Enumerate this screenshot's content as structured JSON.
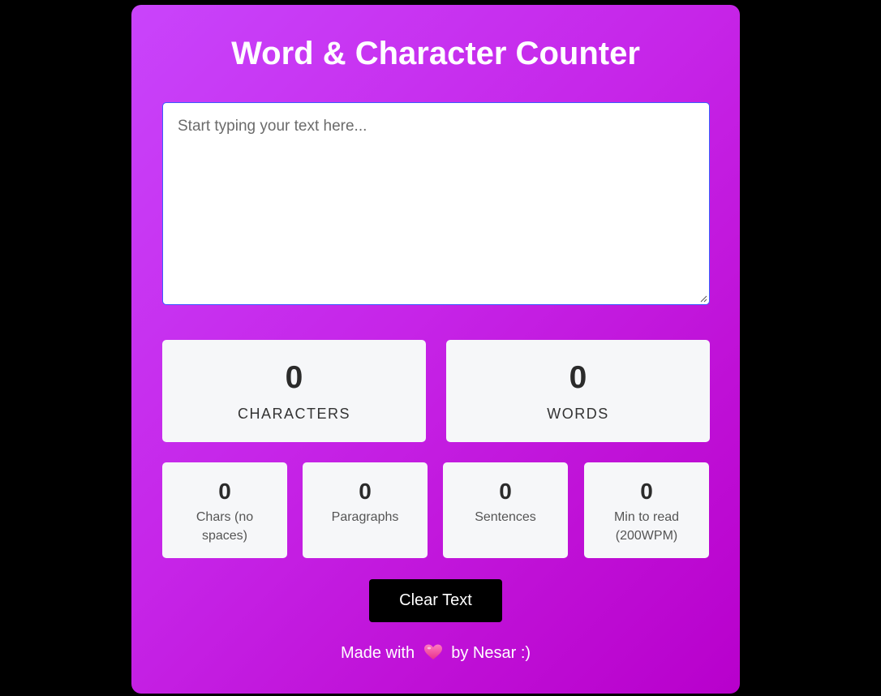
{
  "app": {
    "title": "Word & Character Counter"
  },
  "editor": {
    "value": "",
    "placeholder": "Start typing your text here..."
  },
  "primary_stats": [
    {
      "value": "0",
      "label": "CHARACTERS"
    },
    {
      "value": "0",
      "label": "WORDS"
    }
  ],
  "secondary_stats": [
    {
      "value": "0",
      "label": "Chars (no spaces)"
    },
    {
      "value": "0",
      "label": "Paragraphs"
    },
    {
      "value": "0",
      "label": "Sentences"
    },
    {
      "value": "0",
      "label": "Min to read (200WPM)"
    }
  ],
  "actions": {
    "clear_label": "Clear Text"
  },
  "footer": {
    "prefix": "Made with",
    "icon": "heart-icon",
    "suffix": "by Nesar :)"
  },
  "colors": {
    "page_background": "#000000",
    "card_gradient_start": "#c944fb",
    "card_gradient_end": "#b800cc",
    "stat_card_background": "#f6f7f9",
    "button_background": "#000000",
    "heart": "#ff4fa3"
  }
}
